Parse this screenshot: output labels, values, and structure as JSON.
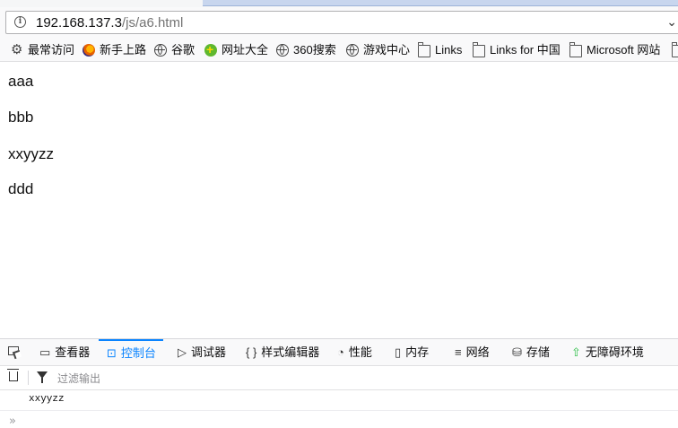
{
  "urlbar": {
    "host": "192.168.137.3",
    "path": "/js/a6.html"
  },
  "bookmarks": [
    {
      "label": "最常访问",
      "icon": "gear-icon"
    },
    {
      "label": "新手上路",
      "icon": "firefox-icon"
    },
    {
      "label": "谷歌",
      "icon": "globe-icon"
    },
    {
      "label": "网址大全",
      "icon": "green-plus-icon"
    },
    {
      "label": "360搜索",
      "icon": "globe-icon"
    },
    {
      "label": "游戏中心",
      "icon": "globe-icon"
    },
    {
      "label": "Links",
      "icon": "folder-icon"
    },
    {
      "label": "Links for 中国",
      "icon": "folder-icon"
    },
    {
      "label": "Microsoft 网站",
      "icon": "folder-icon"
    }
  ],
  "content": {
    "lines": [
      "aaa",
      "bbb",
      "xxyyzz",
      "ddd"
    ]
  },
  "devtools": {
    "tabs": [
      {
        "label": "查看器",
        "icon": "inspector-icon"
      },
      {
        "label": "控制台",
        "icon": "console-icon",
        "active": true
      },
      {
        "label": "调试器",
        "icon": "debugger-icon"
      },
      {
        "label": "样式编辑器",
        "icon": "style-editor-icon"
      },
      {
        "label": "性能",
        "icon": "performance-icon"
      },
      {
        "label": "内存",
        "icon": "memory-icon"
      },
      {
        "label": "网络",
        "icon": "network-icon"
      },
      {
        "label": "存储",
        "icon": "storage-icon"
      },
      {
        "label": "无障碍环境",
        "icon": "accessibility-icon"
      }
    ],
    "filter_placeholder": "过滤输出",
    "log": [
      "xxyyzz"
    ],
    "prompt": "»"
  },
  "colors": {
    "accent": "#0a84ff",
    "accessibility": "#30c04a"
  }
}
